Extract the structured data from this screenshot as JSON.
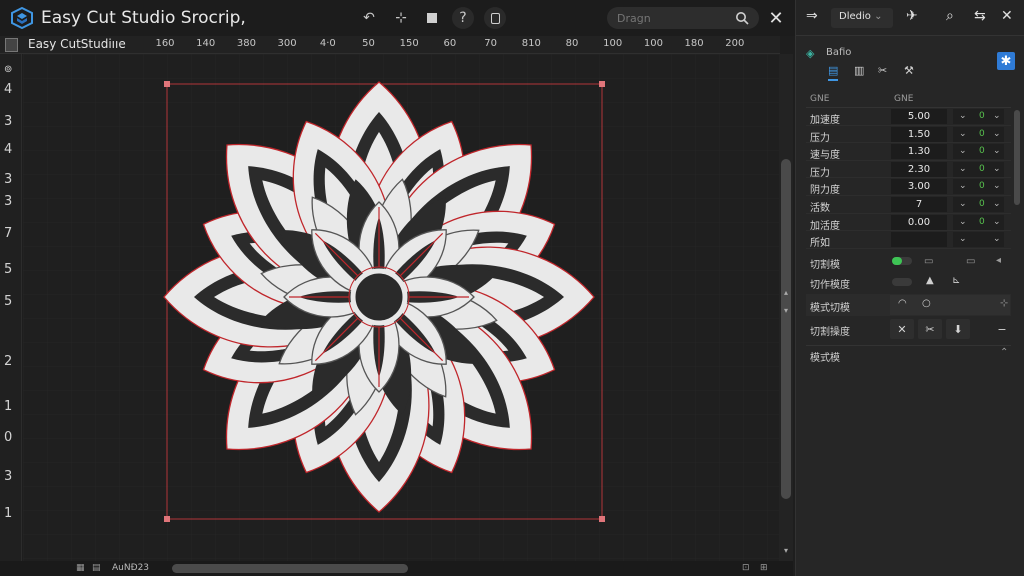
{
  "app": {
    "title": "Easy Cut Studio Srocrip,",
    "accent": "#2f7bd6",
    "icons": [
      "undo-icon",
      "move-icon",
      "stop-icon",
      "help-icon",
      "square-icon"
    ]
  },
  "search": {
    "placeholder": "Dragn"
  },
  "ruler": {
    "label": "Easy CutStudiııe",
    "ticks": [
      "160",
      "140",
      "380",
      "300",
      "4·0",
      "50",
      "150",
      "60",
      "70",
      "810",
      "80",
      "100",
      "100",
      "180",
      "200"
    ],
    "left_ticks": [
      "4",
      "3",
      "4",
      "3",
      "3",
      "7",
      "5",
      "5",
      "2",
      "1",
      "0",
      "3",
      "1"
    ]
  },
  "status": {
    "label": "AuNÐ23"
  },
  "panel": {
    "mode_label": "Dledio",
    "section_title": "Bafio",
    "col1": "GNE",
    "col2": "GNE",
    "rows": [
      {
        "name": "加速度",
        "value": "5.00",
        "num": "0"
      },
      {
        "name": "压力",
        "value": "1.50",
        "num": "0"
      },
      {
        "name": "速与度",
        "value": "1.30",
        "num": "0"
      },
      {
        "name": "压力",
        "value": "2.30",
        "num": "0"
      },
      {
        "name": "阴力度",
        "value": "3.00",
        "num": "0"
      },
      {
        "name": "活数",
        "value": "7",
        "num": "0"
      },
      {
        "name": "加活度",
        "value": "0.00",
        "num": "0"
      },
      {
        "name": "所如",
        "value": "",
        "num": ""
      }
    ],
    "section_rows": [
      {
        "name": "切割模"
      },
      {
        "name": "切作模度"
      },
      {
        "name": "模式切模"
      },
      {
        "name": "切割操度"
      },
      {
        "name": "模式模"
      }
    ]
  },
  "art": {
    "fill_color": "#e9e9e9",
    "dark_color": "#2b2b2b",
    "outline_color": "#c0262b"
  }
}
